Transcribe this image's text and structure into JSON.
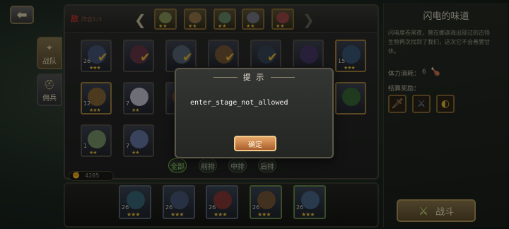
{
  "nav": {
    "back_icon": "back-arrow-icon"
  },
  "side_tabs": [
    {
      "label": "战队",
      "icon": "team-icon"
    },
    {
      "label": "佣兵",
      "icon": "helmet-icon"
    }
  ],
  "enemy_bar": {
    "label": "敌",
    "wave": "阵容1/3"
  },
  "hero_grid": [
    {
      "level": "26",
      "stars": "★★★",
      "selected": true
    },
    {
      "level": "",
      "stars": "",
      "selected": true
    },
    {
      "level": "",
      "stars": "",
      "selected": true
    },
    {
      "level": "",
      "stars": "",
      "selected": true
    },
    {
      "level": "",
      "stars": "",
      "selected": true
    },
    {
      "level": "",
      "stars": "",
      "selected": false
    },
    {
      "level": "15",
      "stars": "★★★",
      "selected": false
    },
    {
      "level": "12",
      "stars": "★★★",
      "selected": false
    },
    {
      "level": "7",
      "stars": "★★",
      "selected": false
    },
    {
      "level": "",
      "stars": "",
      "selected": false
    },
    {
      "level": "",
      "stars": "",
      "selected": false
    },
    {
      "level": "",
      "stars": "",
      "selected": false
    },
    {
      "level": "",
      "stars": "",
      "selected": false
    },
    {
      "level": "",
      "stars": "",
      "selected": false
    },
    {
      "level": "1",
      "stars": "★★",
      "selected": false
    },
    {
      "level": "7",
      "stars": "★★",
      "selected": false
    }
  ],
  "filters": [
    "全部",
    "前排",
    "中排",
    "后排"
  ],
  "power": "4285",
  "team": [
    {
      "level": "26",
      "stars": "★★★"
    },
    {
      "level": "26",
      "stars": "★★★"
    },
    {
      "level": "26",
      "stars": "★★★"
    },
    {
      "level": "26",
      "stars": "★★★"
    },
    {
      "level": "26",
      "stars": "★★★"
    }
  ],
  "stage": {
    "title": "闪电的味道",
    "description": "闪电席卷黑夜，曾在娜迦海出现过的古怪生物再次找到了我们，这次它不会善罢甘休。",
    "cost_label": "体力消耗：",
    "cost_value": "6",
    "reward_label": "结算奖励：",
    "rewards": [
      "sword-icon",
      "dagger-icon",
      "ring-icon"
    ]
  },
  "fight_button": "战斗",
  "dialog": {
    "title": "提 示",
    "message": "enter_stage_not_allowed",
    "confirm": "确定"
  },
  "colors": {
    "accent_gold": "#b29a5c",
    "confirm_orange": "#c87a3c",
    "enemy_red": "#c43a2a"
  }
}
